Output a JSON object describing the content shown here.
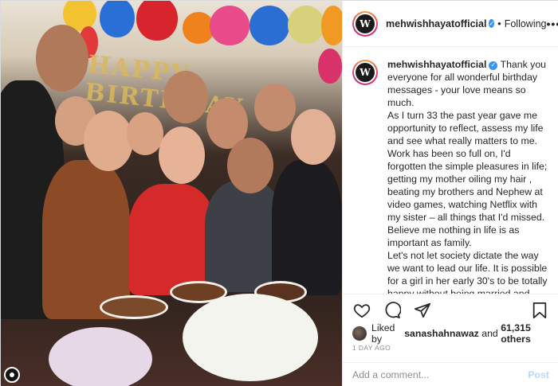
{
  "post": {
    "username": "mehwishhayatofficial",
    "follow_label": "Following",
    "more_label": "•••",
    "avatar_letter": "W",
    "caption": "Thank you everyone for all wonderful birthday messages - your love means so much.\nAs I turn 33 the past year gave me opportunity to reflect, assess my life and see what really matters to me.\nWork has been so full on, I'd forgotten the simple pleasures in life; getting my mother oiling my hair , beating my brothers and Nephew at video games, watching Netflix with my sister – all things that I'd missed.\nBelieve me nothing in life is as important as family.\nLet's not let society dictate the way we want to lead our life. It is possible for a girl in her early 30's to be totally happy without being married and with children. It'll happen when it will and not to some prescribed",
    "likes_prefix": "Liked by",
    "likes_user": "sanashahnawaz",
    "likes_and": "and",
    "likes_count": "61,315 others",
    "timestamp": "1 DAY AGO",
    "comment_placeholder": "Add a comment...",
    "post_label": "Post"
  },
  "photo": {
    "banner_text": "HAPPY BIRTHDAY"
  },
  "icons": [
    "heart-icon",
    "comment-icon",
    "share-icon",
    "bookmark-icon",
    "verified-badge-icon",
    "more-icon"
  ],
  "colors": {
    "verified": "#3897f0",
    "post_disabled": "#b3dbff",
    "muted": "#8e8e8e"
  }
}
